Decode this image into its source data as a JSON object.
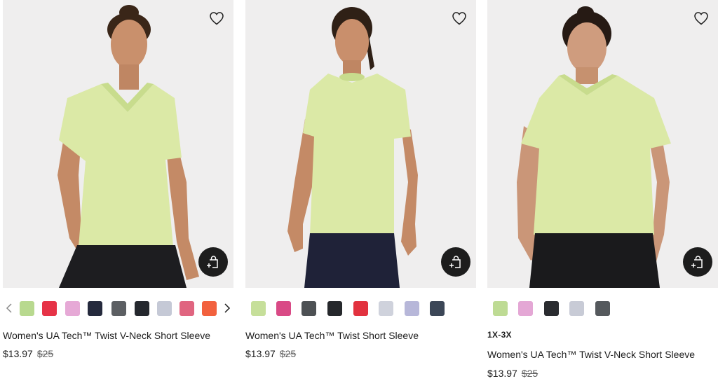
{
  "colors": {
    "shirt": "#dbe9a6",
    "shirt_shade": "#c8dc8d",
    "bg": "#efeeee",
    "dark": "#1d1d1d"
  },
  "icons": {
    "favorite": "heart-icon",
    "quick_add": "bag-plus-icon",
    "prev": "chevron-left-icon",
    "next": "chevron-right-icon"
  },
  "products": [
    {
      "name": "Women's UA Tech™ Twist V-Neck Short Sleeve",
      "sale_price": "$13.97",
      "original_price": "$25",
      "swatches": [
        "#b8d98f",
        "#e63347",
        "#e6a9d6",
        "#252a3d",
        "#5c5f63",
        "#25282e",
        "#c5c9d6",
        "#e06580",
        "#f2613e"
      ]
    },
    {
      "name": "Women's UA Tech™ Twist Short Sleeve",
      "sale_price": "$13.97",
      "original_price": "$25",
      "swatches": [
        "#c6df9a",
        "#d94a86",
        "#4d5154",
        "#26282c",
        "#e2323f",
        "#cfd2dc",
        "#b7b7d9",
        "#3c4757"
      ]
    },
    {
      "size_tag": "1X-3X",
      "name": "Women's UA Tech™ Twist V-Neck Short Sleeve",
      "sale_price": "$13.97",
      "original_price": "$25",
      "swatches": [
        "#bedb94",
        "#e4a7d5",
        "#2a2c30",
        "#c8cbd6",
        "#55595d"
      ]
    }
  ]
}
